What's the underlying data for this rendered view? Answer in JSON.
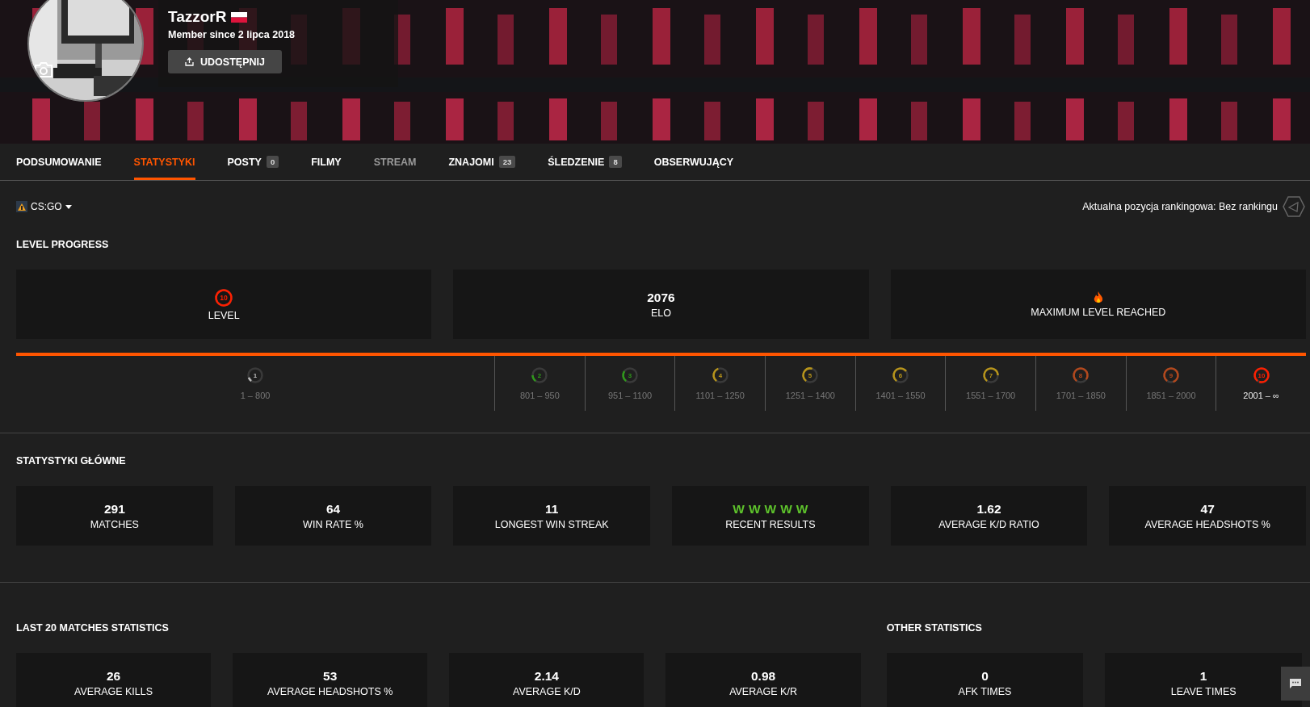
{
  "profile": {
    "name": "TazzorR",
    "member_since": "Member since 2 lipca 2018",
    "share_button": "UDOSTĘPNIJ"
  },
  "tabs": [
    {
      "label": "PODSUMOWANIE",
      "selected": false,
      "disabled": false
    },
    {
      "label": "STATYSTYKI",
      "selected": true,
      "disabled": false
    },
    {
      "label": "POSTY",
      "count": "0",
      "selected": false,
      "disabled": false
    },
    {
      "label": "FILMY",
      "selected": false,
      "disabled": false
    },
    {
      "label": "STREAM",
      "selected": false,
      "disabled": true
    },
    {
      "label": "ZNAJOMI",
      "count": "23",
      "selected": false,
      "disabled": false
    },
    {
      "label": "ŚLEDZENIE",
      "count": "8",
      "selected": false,
      "disabled": false
    },
    {
      "label": "OBSERWUJĄCY",
      "selected": false,
      "disabled": false
    }
  ],
  "game_selector": {
    "label": "CS:GO"
  },
  "ranking": "Aktualna pozycja rankingowa: Bez rankingu",
  "level_progress": {
    "title": "LEVEL PROGRESS",
    "cards": [
      {
        "kind": "level",
        "value": "10",
        "label": "LEVEL"
      },
      {
        "kind": "number",
        "value": "2076",
        "label": "ELO"
      },
      {
        "kind": "flame",
        "label": "MAXIMUM LEVEL REACHED"
      }
    ],
    "level": 1,
    "levels": [
      {
        "number": "1",
        "range": "1 – 800",
        "color": "#bbbbbb",
        "selected": false
      },
      {
        "number": "2",
        "range": "801 – 950",
        "color": "#2f9a1a",
        "selected": false
      },
      {
        "number": "3",
        "range": "951 – 1100",
        "color": "#2f9a1a",
        "selected": false
      },
      {
        "number": "4",
        "range": "1101 – 1250",
        "color": "#b8951a",
        "selected": false
      },
      {
        "number": "5",
        "range": "1251 – 1400",
        "color": "#b8951a",
        "selected": false
      },
      {
        "number": "6",
        "range": "1401 – 1550",
        "color": "#b8951a",
        "selected": false
      },
      {
        "number": "7",
        "range": "1551 – 1700",
        "color": "#b8951a",
        "selected": false
      },
      {
        "number": "8",
        "range": "1701 – 1850",
        "color": "#b4481c",
        "selected": false
      },
      {
        "number": "9",
        "range": "1851 – 2000",
        "color": "#b4481c",
        "selected": false
      },
      {
        "number": "10",
        "range": "2001 – ∞",
        "color": "#fe1f00",
        "selected": true
      }
    ]
  },
  "main_stats": {
    "title": "STATYSTYKI GŁÓWNE",
    "cards": [
      {
        "kind": "number",
        "value": "291",
        "label": "MATCHES"
      },
      {
        "kind": "number",
        "value": "64",
        "label": "WIN RATE %"
      },
      {
        "kind": "number",
        "value": "11",
        "label": "LONGEST WIN STREAK"
      },
      {
        "kind": "results",
        "results": [
          "W",
          "W",
          "W",
          "W",
          "W"
        ],
        "label": "RECENT RESULTS"
      },
      {
        "kind": "number",
        "value": "1.62",
        "label": "AVERAGE K/D RATIO"
      },
      {
        "kind": "number",
        "value": "47",
        "label": "AVERAGE HEADSHOTS %"
      }
    ]
  },
  "last_20": {
    "title": "LAST 20 MATCHES STATISTICS",
    "cards": [
      {
        "kind": "number",
        "value": "26",
        "label": "AVERAGE KILLS"
      },
      {
        "kind": "number",
        "value": "53",
        "label": "AVERAGE HEADSHOTS %"
      },
      {
        "kind": "number",
        "value": "2.14",
        "label": "AVERAGE K/D"
      },
      {
        "kind": "number",
        "value": "0.98",
        "label": "AVERAGE K/R"
      }
    ]
  },
  "other_stats": {
    "title": "OTHER STATISTICS",
    "cards": [
      {
        "kind": "number",
        "value": "0",
        "label": "AFK TIMES"
      },
      {
        "kind": "number",
        "value": "1",
        "label": "LEAVE TIMES"
      }
    ]
  }
}
